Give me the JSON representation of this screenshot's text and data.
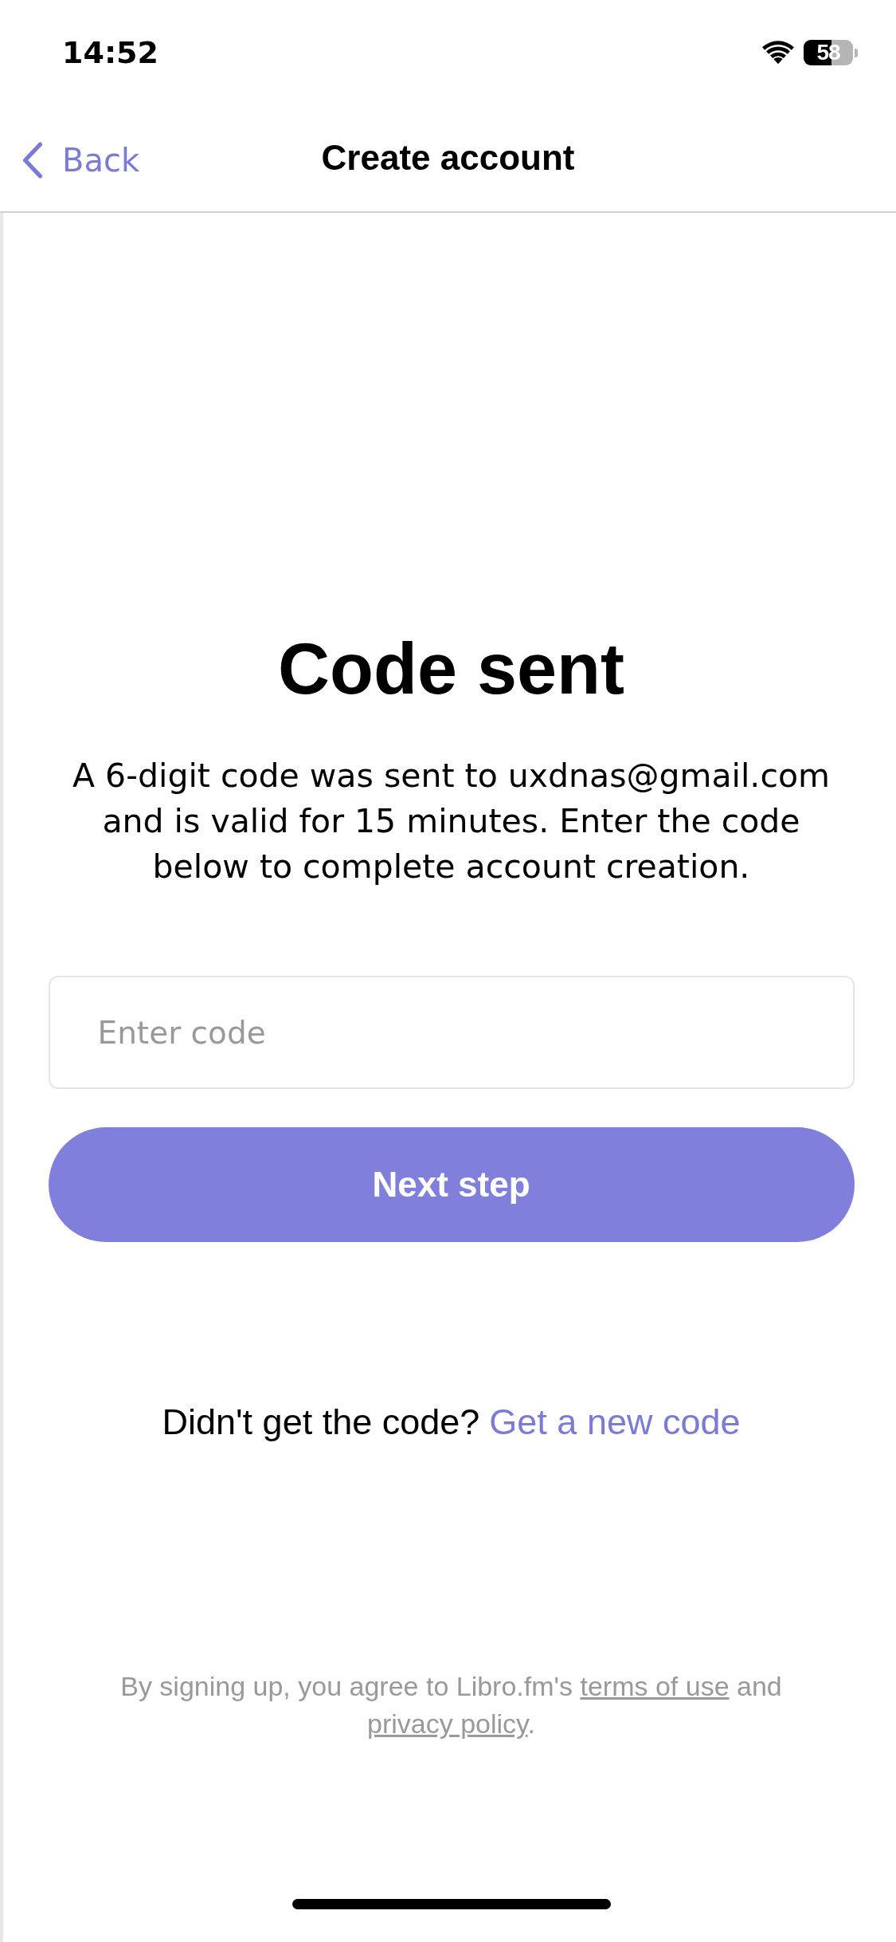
{
  "status_bar": {
    "time": "14:52",
    "battery": "58"
  },
  "nav": {
    "back": "Back",
    "title": "Create account"
  },
  "heading": "Code sent",
  "message": "A 6-digit code was sent to uxdnas@gmail.com and is valid for 15 minutes. Enter the code below to complete account creation.",
  "code_field": {
    "placeholder": "Enter code"
  },
  "next_button": {
    "label": "Next step"
  },
  "resend": {
    "prompt": "Didn't get the code?",
    "link": "Get a new code"
  },
  "footer": {
    "before": "By signing up, you agree to Libro.fm's ",
    "terms_link": "terms of use",
    "middle": " and ",
    "privacy_link": "privacy policy",
    "after": "."
  }
}
